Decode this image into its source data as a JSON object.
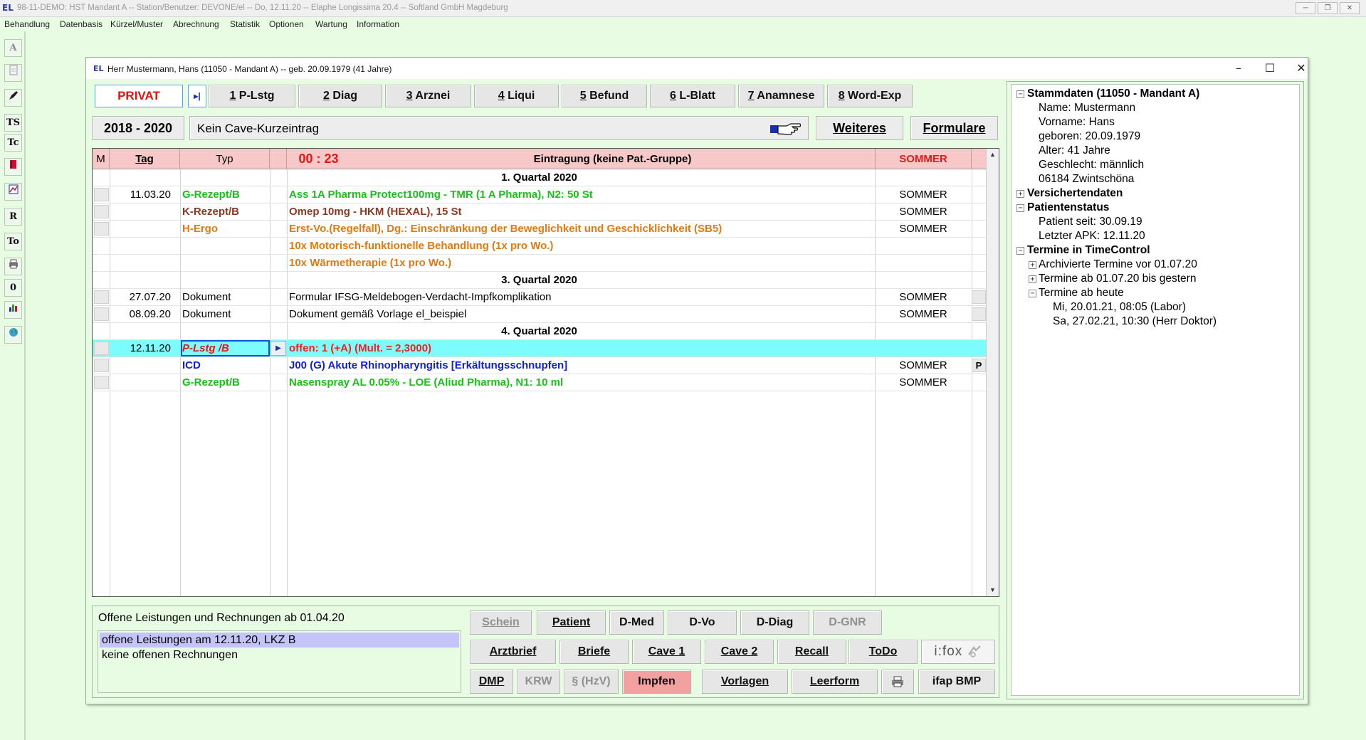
{
  "app": {
    "logo": "EL",
    "title": "98-11-DEMO: HST Mandant A -- Station/Benutzer: DEVONE/el -- Do, 12.11.20 -- Elaphe Longissima 20.4 -- Softland GmbH Magdeburg",
    "menu": [
      "Behandlung",
      "Datenbasis",
      "Kürzel/Muster",
      "Abrechnung",
      "Statistik",
      "Optionen",
      "Wartung",
      "Information"
    ]
  },
  "left_toolbar": [
    "A",
    "",
    "",
    "TS",
    "Tc",
    "",
    "",
    "R",
    "To",
    "",
    "0",
    "",
    ""
  ],
  "window": {
    "logo": "EL",
    "title": "Herr Mustermann, Hans (11050 - Mandant A) -- geb. 20.09.1979 (41 Jahre)"
  },
  "tabs": {
    "privat": "PRIVAT",
    "play": "▸|",
    "items": [
      {
        "num": "1",
        "label": " P-Lstg"
      },
      {
        "num": "2",
        "label": " Diag"
      },
      {
        "num": "3",
        "label": " Arznei"
      },
      {
        "num": "4",
        "label": " Liqui"
      },
      {
        "num": "5",
        "label": " Befund"
      },
      {
        "num": "6",
        "label": " L-Blatt"
      },
      {
        "num": "7",
        "label": " Anamnese"
      },
      {
        "num": "8",
        "label": " Word-Exp"
      }
    ]
  },
  "header": {
    "years": "2018 - 2020",
    "cave_text": "Kein Cave-Kurzeintrag",
    "weiteres": "Weiteres",
    "formulare": "Formulare"
  },
  "journal": {
    "columns": {
      "m": "M",
      "tag": "Tag",
      "typ": "Typ",
      "time": "00 : 23",
      "entry": "Eintragung (keine Pat.-Gruppe)",
      "user": "SOMMER"
    },
    "rows": [
      {
        "kind": "section",
        "text": "1. Quartal 2020"
      },
      {
        "kind": "entry",
        "day": "11.03.20",
        "typ": "G-Rezept/B",
        "entry": "Ass 1A Pharma Protect100mg - TMR (1 A Pharma), N2: 50 St",
        "user": "SOMMER",
        "color": "green",
        "m": true
      },
      {
        "kind": "entry",
        "day": "",
        "typ": "K-Rezept/B",
        "entry": "Omep 10mg - HKM (HEXAL), 15 St",
        "user": "SOMMER",
        "color": "brown",
        "m": true
      },
      {
        "kind": "entry",
        "day": "",
        "typ": "H-Ergo",
        "entry": "Erst-Vo.(Regelfall), Dg.: Einschränkung der Beweglichkeit und Geschicklichkeit (SB5)",
        "user": "SOMMER",
        "color": "orange",
        "m": true
      },
      {
        "kind": "entry",
        "day": "",
        "typ": "",
        "entry": "10x Motorisch-funktionelle Behandlung (1x pro Wo.)",
        "user": "",
        "color": "orange",
        "m": false
      },
      {
        "kind": "entry",
        "day": "",
        "typ": "",
        "entry": "10x Wärmetherapie (1x pro Wo.)",
        "user": "",
        "color": "orange",
        "m": false
      },
      {
        "kind": "section",
        "text": "3. Quartal 2020"
      },
      {
        "kind": "entry",
        "day": "27.07.20",
        "typ": "Dokument",
        "entry": "Formular IFSG-Meldebogen-Verdacht-Impfkomplikation",
        "user": "SOMMER",
        "color": "plain",
        "m": true,
        "flag": " "
      },
      {
        "kind": "entry",
        "day": "08.09.20",
        "typ": "Dokument",
        "entry": "Dokument gemäß Vorlage el_beispiel",
        "user": "SOMMER",
        "color": "plain",
        "m": true,
        "flag": " "
      },
      {
        "kind": "section",
        "text": "4. Quartal 2020"
      },
      {
        "kind": "selected",
        "day": "12.11.20",
        "typ": "P-Lstg /B",
        "entry": "offen: 1 (+A) (Mult. = 2,3000)",
        "user": "",
        "color": "red",
        "m": true
      },
      {
        "kind": "entry",
        "day": "",
        "typ": "ICD",
        "entry": "J00 (G)  Akute Rhinopharyngitis [Erkältungsschnupfen]",
        "user": "SOMMER",
        "color": "blue",
        "m": true,
        "flag": "P"
      },
      {
        "kind": "entry",
        "day": "",
        "typ": "G-Rezept/B",
        "entry": "Nasenspray AL 0.05% - LOE (Aliud Pharma), N1: 10 ml",
        "user": "SOMMER",
        "color": "green",
        "m": true
      }
    ]
  },
  "open_items": {
    "title": "Offene Leistungen und Rechnungen ab 01.04.20",
    "items": [
      "offene Leistungen am 12.11.20, LKZ B",
      "keine offenen Rechnungen"
    ]
  },
  "buttons": {
    "row1": [
      "Schein",
      "Patient",
      "D-Med",
      "D-Vo",
      "D-Diag",
      "D-GNR"
    ],
    "row2": [
      "Arztbrief",
      "Briefe",
      "Cave 1",
      "Cave 2",
      "Recall",
      "ToDo",
      "i:fox"
    ],
    "row3": [
      "DMP",
      "KRW",
      "§ (HzV)",
      "Impfen",
      "Vorlagen",
      "Leerform",
      "",
      "ifap BMP"
    ]
  },
  "tree": {
    "stammdaten": "Stammdaten (11050 - Mandant A)",
    "name": "Name: Mustermann",
    "vorname": "Vorname: Hans",
    "geboren": "geboren: 20.09.1979",
    "alter": "Alter: 41 Jahre",
    "geschlecht": "Geschlecht: männlich",
    "ort": "06184 Zwintschöna",
    "versicherten": "Versichertendaten",
    "patientenstatus": "Patientenstatus",
    "patient_seit": "Patient seit: 30.09.19",
    "letzter_apk": "Letzter APK: 12.11.20",
    "termine": "Termine in TimeControl",
    "archiv": "Archivierte Termine vor 01.07.20",
    "bis_gestern": "Termine ab 01.07.20 bis gestern",
    "ab_heute": "Termine ab heute",
    "termin1": "Mi, 20.01.21, 08:05 (Labor)",
    "termin2": "Sa, 27.02.21, 10:30 (Herr Doktor)"
  }
}
